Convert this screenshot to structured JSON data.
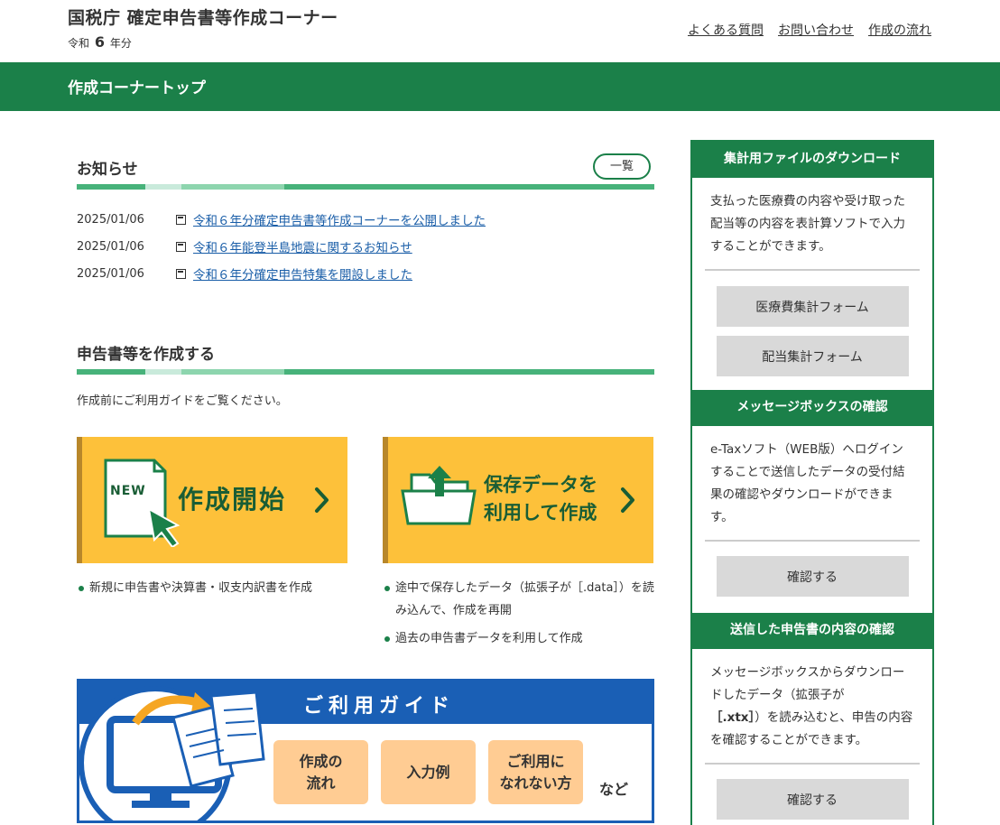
{
  "header": {
    "title": "国税庁 確定申告書等作成コーナー",
    "year_prefix": "令和",
    "year_num": "6",
    "year_suffix": "年分",
    "links": [
      "よくある質問",
      "お問い合わせ",
      "作成の流れ"
    ]
  },
  "page_title": "作成コーナートップ",
  "notices": {
    "heading": "お知らせ",
    "list_button": "一覧",
    "items": [
      {
        "date": "2025/01/06",
        "text": "令和６年分確定申告書等作成コーナーを公開しました"
      },
      {
        "date": "2025/01/06",
        "text": "令和６年能登半島地震に関するお知らせ"
      },
      {
        "date": "2025/01/06",
        "text": "令和６年分確定申告特集を開設しました"
      }
    ]
  },
  "create": {
    "heading": "申告書等を作成する",
    "intro": "作成前にご利用ガイドをご覧ください。",
    "start_tile": {
      "badge": "NEW",
      "label": "作成開始"
    },
    "saved_tile": {
      "label_line1": "保存データを",
      "label_line2": "利用して作成"
    },
    "start_bullets": [
      "新規に申告書や決算書・収支内訳書を作成"
    ],
    "saved_bullets": [
      "途中で保存したデータ（拡張子が［.data］）を読み込んで、作成を再開",
      "過去の申告書データを利用して作成"
    ]
  },
  "guide": {
    "title": "ご利用ガイド",
    "buttons": [
      {
        "line1": "作成の",
        "line2": "流れ"
      },
      {
        "line1": "入力例",
        "line2": ""
      },
      {
        "line1": "ご利用に",
        "line2": "なれない方"
      }
    ],
    "etc": "など"
  },
  "sidebar": {
    "download": {
      "heading": "集計用ファイルのダウンロード",
      "text": "支払った医療費の内容や受け取った配当等の内容を表計算ソフトで入力することができます。",
      "buttons": [
        "医療費集計フォーム",
        "配当集計フォーム"
      ]
    },
    "messagebox": {
      "heading": "メッセージボックスの確認",
      "text": "e-Taxソフト（WEB版）へログインすることで送信したデータの受付結果の確認やダウンロードができます。",
      "button": "確認する"
    },
    "sent": {
      "heading": "送信した申告書の内容の確認",
      "text_before": "メッセージボックスからダウンロードしたデータ（拡張子が",
      "ext": "［.xtx］",
      "text_after": "）を読み込むと、申告の内容を確認することができます。",
      "button": "確認する"
    }
  },
  "colors": {
    "green": "#1b8049",
    "yellow": "#fdc13a",
    "blue": "#1a5fb5",
    "orange": "#ffcc93"
  }
}
